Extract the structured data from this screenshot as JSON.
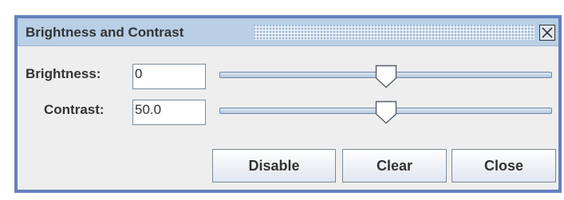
{
  "dialog": {
    "title": "Brightness and Contrast",
    "close_icon": "close-box-icon"
  },
  "brightness": {
    "label": "Brightness:",
    "value": "0",
    "slider_fraction": 0.5
  },
  "contrast": {
    "label": "Contrast:",
    "value": "50.0",
    "slider_fraction": 0.5
  },
  "buttons": {
    "disable": "Disable",
    "clear": "Clear",
    "close": "Close"
  },
  "colors": {
    "frame_border": "#6382bf",
    "titlebar": "#b8cfe5",
    "dialog_background": "#eeeeee"
  }
}
